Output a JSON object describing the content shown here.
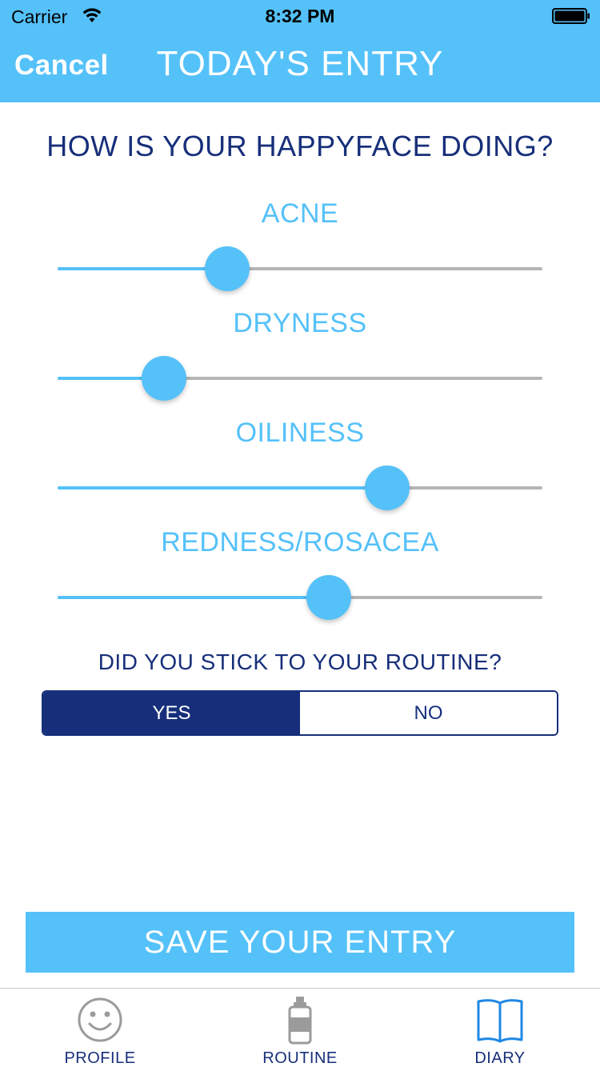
{
  "status_bar": {
    "carrier": "Carrier",
    "time": "8:32 PM"
  },
  "nav": {
    "cancel_label": "Cancel",
    "title": "TODAY'S ENTRY"
  },
  "question": "HOW IS YOUR HAPPYFACE DOING?",
  "sliders": [
    {
      "label": "ACNE",
      "value": 0.35
    },
    {
      "label": "DRYNESS",
      "value": 0.22
    },
    {
      "label": "OILINESS",
      "value": 0.68
    },
    {
      "label": "REDNESS/ROSACEA",
      "value": 0.56
    }
  ],
  "routine": {
    "question": "DID YOU STICK TO YOUR ROUTINE?",
    "yes_label": "YES",
    "no_label": "NO",
    "selected": "YES"
  },
  "save_label": "SAVE YOUR ENTRY",
  "tabs": [
    {
      "label": "PROFILE",
      "icon": "smiley-icon"
    },
    {
      "label": "ROUTINE",
      "icon": "bottle-icon"
    },
    {
      "label": "DIARY",
      "icon": "book-icon",
      "active": true
    }
  ],
  "colors": {
    "accent": "#55c1f9",
    "navy": "#172f7a",
    "track": "#b5b5b5"
  }
}
